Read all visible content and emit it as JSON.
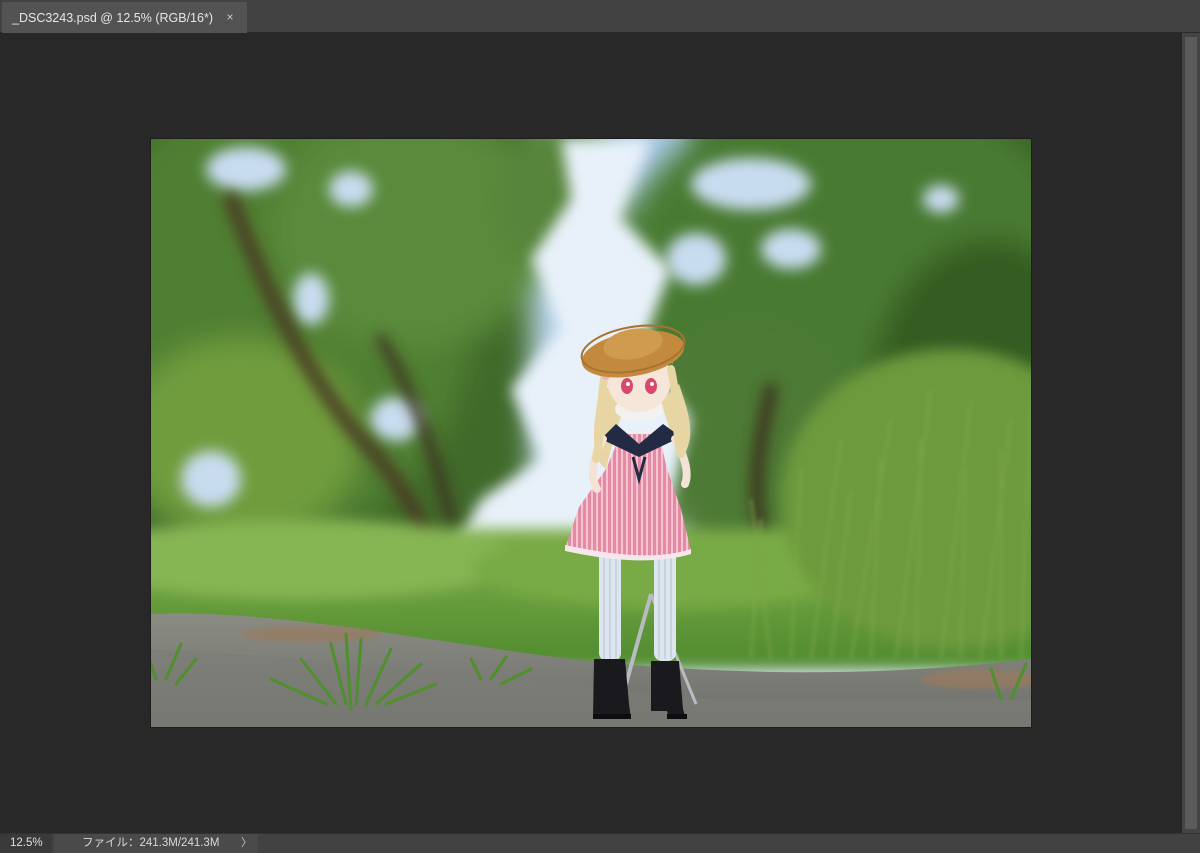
{
  "document_tab": {
    "title": "_DSC3243.psd @ 12.5% (RGB/16*)",
    "close_glyph": "×"
  },
  "status_bar": {
    "zoom": "12.5%",
    "file_info": "ファイル：241.3M/241.3M",
    "menu_glyph": "〉"
  },
  "icons": {
    "close": "close-icon",
    "status_menu": "chevron-right-icon"
  },
  "colors": {
    "workspace": "#282828",
    "tab_active": "#535353",
    "panel": "#424242"
  }
}
